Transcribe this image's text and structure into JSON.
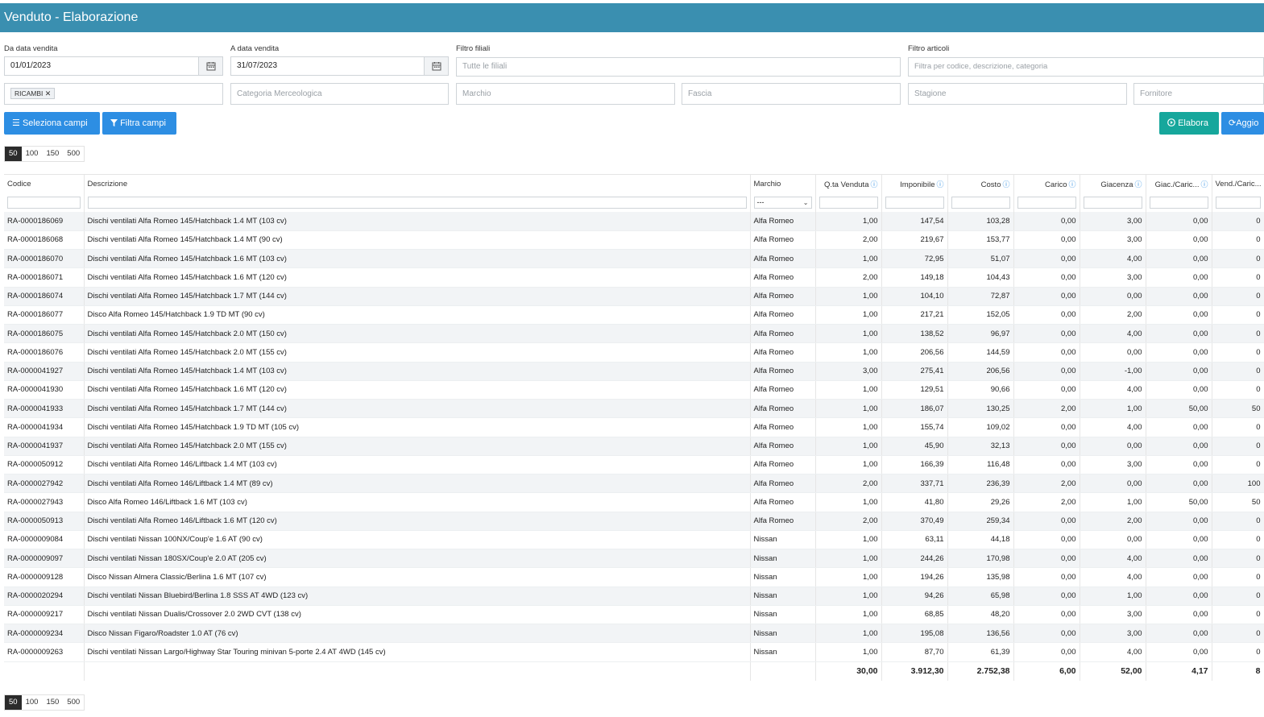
{
  "title": "Venduto - Elaborazione",
  "filters": {
    "da_data_label": "Da data vendita",
    "da_data_value": "01/01/2023",
    "a_data_label": "A data vendita",
    "a_data_value": "31/07/2023",
    "filiali_label": "Filtro filiali",
    "filiali_placeholder": "Tutte le filiali",
    "articoli_label": "Filtro articoli",
    "articoli_placeholder": "Filtra per codice, descrizione, categoria",
    "tag_ricambi": "RICAMBI",
    "categoria_placeholder": "Categoria Merceologica",
    "marchio_placeholder": "Marchio",
    "fascia_placeholder": "Fascia",
    "stagione_placeholder": "Stagione",
    "fornitore_placeholder": "Fornitore"
  },
  "buttons": {
    "seleziona": "Seleziona campi",
    "filtra": "Filtra campi",
    "elabora": "Elabora",
    "aggiorna": "Aggio"
  },
  "pager": [
    "50",
    "100",
    "150",
    "500"
  ],
  "columns": [
    "Codice",
    "Descrizione",
    "Marchio",
    "Q.ta Venduta",
    "Imponibile",
    "Costo",
    "Carico",
    "Giacenza",
    "Giac./Caric...",
    "Vend./Caric..."
  ],
  "marchio_filter_value": "---",
  "rows": [
    [
      "RA-0000186069",
      "Dischi ventilati Alfa Romeo 145/Hatchback 1.4 MT (103 cv)",
      "Alfa Romeo",
      "1,00",
      "147,54",
      "103,28",
      "0,00",
      "3,00",
      "0,00",
      "0"
    ],
    [
      "RA-0000186068",
      "Dischi ventilati Alfa Romeo 145/Hatchback 1.4 MT (90 cv)",
      "Alfa Romeo",
      "2,00",
      "219,67",
      "153,77",
      "0,00",
      "3,00",
      "0,00",
      "0"
    ],
    [
      "RA-0000186070",
      "Dischi ventilati Alfa Romeo 145/Hatchback 1.6 MT (103 cv)",
      "Alfa Romeo",
      "1,00",
      "72,95",
      "51,07",
      "0,00",
      "4,00",
      "0,00",
      "0"
    ],
    [
      "RA-0000186071",
      "Dischi ventilati Alfa Romeo 145/Hatchback 1.6 MT (120 cv)",
      "Alfa Romeo",
      "2,00",
      "149,18",
      "104,43",
      "0,00",
      "3,00",
      "0,00",
      "0"
    ],
    [
      "RA-0000186074",
      "Dischi ventilati Alfa Romeo 145/Hatchback 1.7 MT (144 cv)",
      "Alfa Romeo",
      "1,00",
      "104,10",
      "72,87",
      "0,00",
      "0,00",
      "0,00",
      "0"
    ],
    [
      "RA-0000186077",
      "Disco Alfa Romeo 145/Hatchback 1.9 TD MT (90 cv)",
      "Alfa Romeo",
      "1,00",
      "217,21",
      "152,05",
      "0,00",
      "2,00",
      "0,00",
      "0"
    ],
    [
      "RA-0000186075",
      "Dischi ventilati Alfa Romeo 145/Hatchback 2.0 MT (150 cv)",
      "Alfa Romeo",
      "1,00",
      "138,52",
      "96,97",
      "0,00",
      "4,00",
      "0,00",
      "0"
    ],
    [
      "RA-0000186076",
      "Dischi ventilati Alfa Romeo 145/Hatchback 2.0 MT (155 cv)",
      "Alfa Romeo",
      "1,00",
      "206,56",
      "144,59",
      "0,00",
      "0,00",
      "0,00",
      "0"
    ],
    [
      "RA-0000041927",
      "Dischi ventilati Alfa Romeo 145/Hatchback 1.4 MT (103 cv)",
      "Alfa Romeo",
      "3,00",
      "275,41",
      "206,56",
      "0,00",
      "-1,00",
      "0,00",
      "0"
    ],
    [
      "RA-0000041930",
      "Dischi ventilati Alfa Romeo 145/Hatchback 1.6 MT (120 cv)",
      "Alfa Romeo",
      "1,00",
      "129,51",
      "90,66",
      "0,00",
      "4,00",
      "0,00",
      "0"
    ],
    [
      "RA-0000041933",
      "Dischi ventilati Alfa Romeo 145/Hatchback 1.7 MT (144 cv)",
      "Alfa Romeo",
      "1,00",
      "186,07",
      "130,25",
      "2,00",
      "1,00",
      "50,00",
      "50"
    ],
    [
      "RA-0000041934",
      "Dischi ventilati Alfa Romeo 145/Hatchback 1.9 TD MT (105 cv)",
      "Alfa Romeo",
      "1,00",
      "155,74",
      "109,02",
      "0,00",
      "4,00",
      "0,00",
      "0"
    ],
    [
      "RA-0000041937",
      "Dischi ventilati Alfa Romeo 145/Hatchback 2.0 MT (155 cv)",
      "Alfa Romeo",
      "1,00",
      "45,90",
      "32,13",
      "0,00",
      "0,00",
      "0,00",
      "0"
    ],
    [
      "RA-0000050912",
      "Dischi ventilati Alfa Romeo 146/Liftback 1.4 MT (103 cv)",
      "Alfa Romeo",
      "1,00",
      "166,39",
      "116,48",
      "0,00",
      "3,00",
      "0,00",
      "0"
    ],
    [
      "RA-0000027942",
      "Dischi ventilati Alfa Romeo 146/Liftback 1.4 MT (89 cv)",
      "Alfa Romeo",
      "2,00",
      "337,71",
      "236,39",
      "2,00",
      "0,00",
      "0,00",
      "100"
    ],
    [
      "RA-0000027943",
      "Disco Alfa Romeo 146/Liftback 1.6 MT (103 cv)",
      "Alfa Romeo",
      "1,00",
      "41,80",
      "29,26",
      "2,00",
      "1,00",
      "50,00",
      "50"
    ],
    [
      "RA-0000050913",
      "Dischi ventilati Alfa Romeo 146/Liftback 1.6 MT (120 cv)",
      "Alfa Romeo",
      "2,00",
      "370,49",
      "259,34",
      "0,00",
      "2,00",
      "0,00",
      "0"
    ],
    [
      "RA-0000009084",
      "Dischi ventilati Nissan 100NX/Coup'e 1.6 AT (90 cv)",
      "Nissan",
      "1,00",
      "63,11",
      "44,18",
      "0,00",
      "0,00",
      "0,00",
      "0"
    ],
    [
      "RA-0000009097",
      "Dischi ventilati Nissan 180SX/Coup'e 2.0 AT (205 cv)",
      "Nissan",
      "1,00",
      "244,26",
      "170,98",
      "0,00",
      "4,00",
      "0,00",
      "0"
    ],
    [
      "RA-0000009128",
      "Disco Nissan Almera Classic/Berlina 1.6 MT (107 cv)",
      "Nissan",
      "1,00",
      "194,26",
      "135,98",
      "0,00",
      "4,00",
      "0,00",
      "0"
    ],
    [
      "RA-0000020294",
      "Dischi ventilati Nissan Bluebird/Berlina 1.8 SSS AT 4WD (123 cv)",
      "Nissan",
      "1,00",
      "94,26",
      "65,98",
      "0,00",
      "1,00",
      "0,00",
      "0"
    ],
    [
      "RA-0000009217",
      "Dischi ventilati Nissan Dualis/Crossover 2.0 2WD CVT (138 cv)",
      "Nissan",
      "1,00",
      "68,85",
      "48,20",
      "0,00",
      "3,00",
      "0,00",
      "0"
    ],
    [
      "RA-0000009234",
      "Disco Nissan Figaro/Roadster 1.0 AT (76 cv)",
      "Nissan",
      "1,00",
      "195,08",
      "136,56",
      "0,00",
      "3,00",
      "0,00",
      "0"
    ],
    [
      "RA-0000009263",
      "Dischi ventilati Nissan Largo/Highway Star Touring minivan 5-porte 2.4 AT 4WD (145 cv)",
      "Nissan",
      "1,00",
      "87,70",
      "61,39",
      "0,00",
      "4,00",
      "0,00",
      "0"
    ]
  ],
  "totals": [
    "",
    "",
    "",
    "30,00",
    "3.912,30",
    "2.752,38",
    "6,00",
    "52,00",
    "4,17",
    "8"
  ],
  "colors": {
    "header": "#3a8fb0",
    "button_blue": "#2d8ee3",
    "button_teal": "#16a79c"
  },
  "icons": {
    "calendar": "calendar-icon",
    "remove_tag": "close-icon",
    "list": "list-icon",
    "filter": "filter-icon",
    "play": "play-circle-icon",
    "refresh": "refresh-icon",
    "info": "info-icon",
    "chevron": "chevron-down-icon"
  }
}
